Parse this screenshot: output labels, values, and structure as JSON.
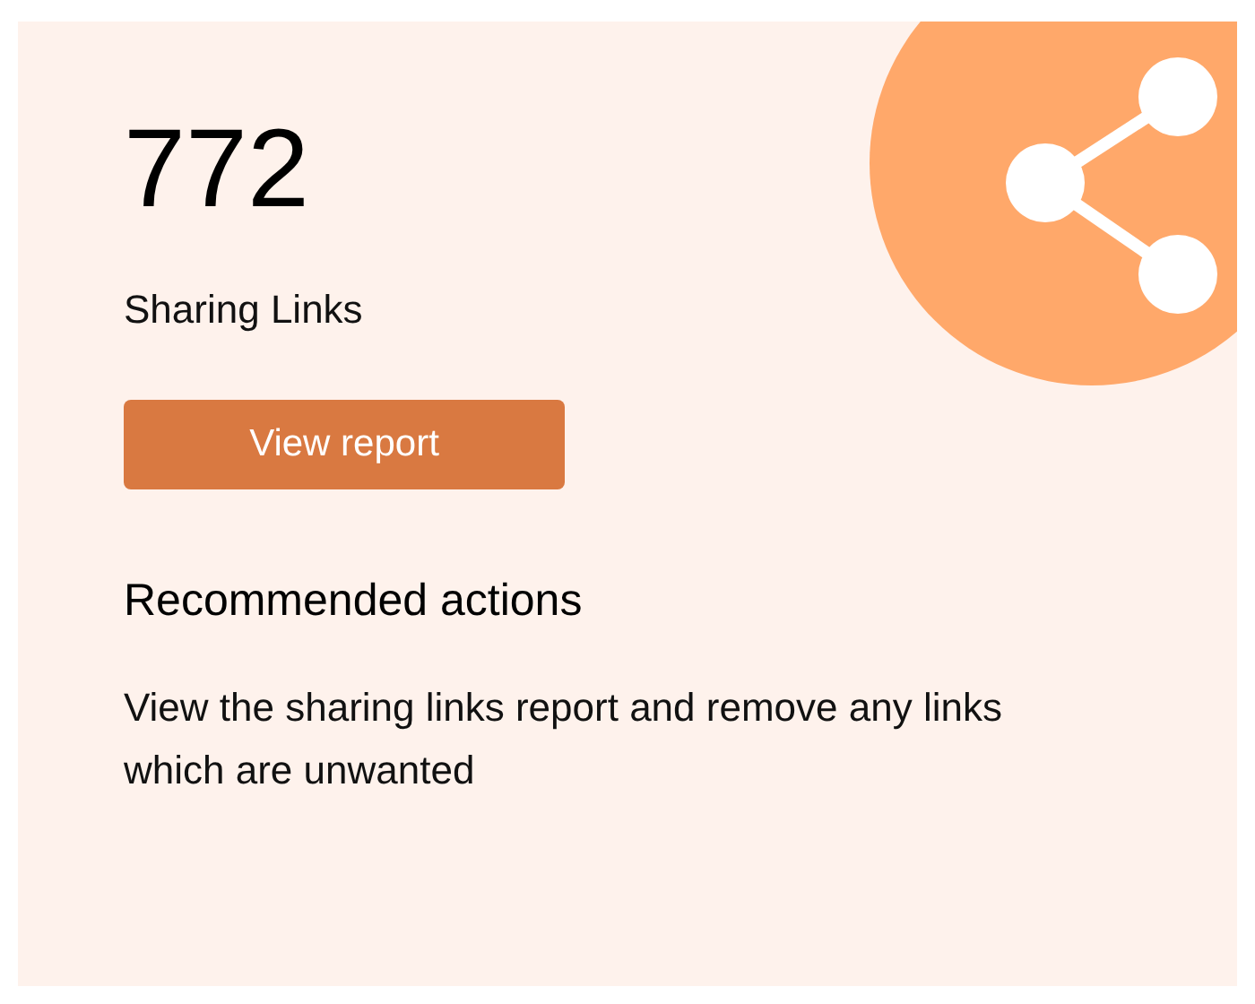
{
  "card": {
    "count": "772",
    "label": "Sharing Links",
    "button": "View report",
    "heading": "Recommended actions",
    "description": "View the sharing links report and remove any links which are unwanted"
  }
}
